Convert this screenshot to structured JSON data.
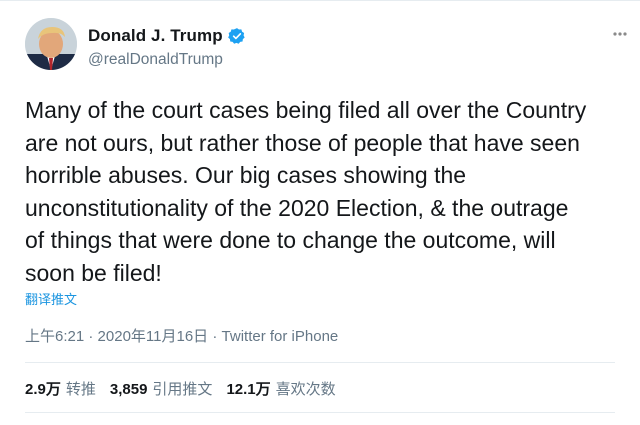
{
  "author": {
    "display_name": "Donald J. Trump",
    "handle": "@realDonaldTrump",
    "verified": true
  },
  "icons": {
    "verified": "verified-badge-icon",
    "more": "more-options-icon",
    "avatar": "profile-avatar"
  },
  "tweet": {
    "text": "Many of the court cases being filed all over the Country\nare not ours, but rather those of people that have seen\nhorrible abuses. Our big cases showing the\nunconstitutionality of the 2020 Election, & the outrage\nof things that were done to change the outcome, will\nsoon be filed!",
    "translate_link": "翻译推文"
  },
  "meta": {
    "time": "上午6:21",
    "separator": " · ",
    "date": "2020年11月16日",
    "client": "Twitter for iPhone"
  },
  "stats": [
    {
      "value": "2.9万",
      "label": "转推"
    },
    {
      "value": "3,859",
      "label": "引用推文"
    },
    {
      "value": "12.1万",
      "label": "喜欢次数"
    }
  ],
  "colors": {
    "accent": "#1b95e0",
    "text": "#14171a",
    "secondary": "#657786",
    "verified": "#1da1f2"
  }
}
